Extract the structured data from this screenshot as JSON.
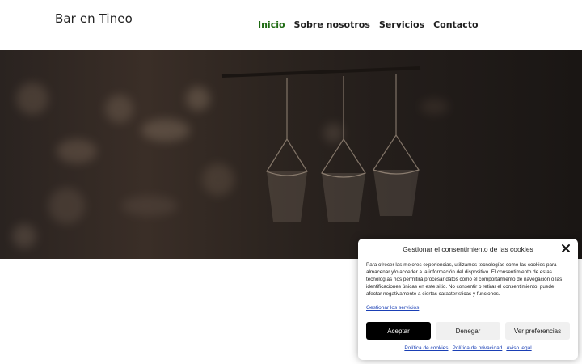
{
  "header": {
    "site_title": "Bar en Tineo",
    "nav": [
      {
        "label": "Inicio",
        "active": true
      },
      {
        "label": "Sobre nosotros",
        "active": false
      },
      {
        "label": "Servicios",
        "active": false
      },
      {
        "label": "Contacto",
        "active": false
      }
    ]
  },
  "cookie_banner": {
    "title": "Gestionar el consentimiento de las cookies",
    "body": "Para ofrecer las mejores experiencias, utilizamos tecnologías como las cookies para almacenar y/o acceder a la información del dispositivo. El consentimiento de estas tecnologías nos permitirá procesar datos como el comportamiento de navegación o las identificaciones únicas en este sitio. No consentir o retirar el consentimiento, puede afectar negativamente a ciertas características y funciones.",
    "manage_services": "Gestionar los servicios",
    "accept": "Aceptar",
    "deny": "Denegar",
    "preferences": "Ver preferencias",
    "links": {
      "cookie_policy": "Política de cookies",
      "privacy_policy": "Política de privacidad",
      "legal_notice": "Aviso legal"
    }
  },
  "colors": {
    "nav_active": "#1e6b12",
    "link": "#1a3fb5",
    "accept_button": "#000000"
  }
}
